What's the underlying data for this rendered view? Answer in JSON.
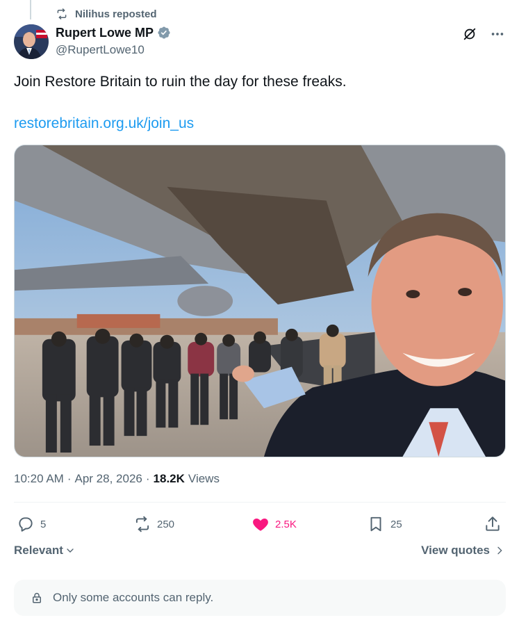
{
  "repost": {
    "label": "Nilihus reposted",
    "icon": "repost-icon"
  },
  "author": {
    "display_name": "Rupert Lowe MP",
    "handle": "@RupertLowe10",
    "verified": true,
    "verified_color": "#829aab"
  },
  "tweet": {
    "text": "Join Restore Britain to ruin the day for these freaks.",
    "link": "restorebritain.org.uk/join_us"
  },
  "meta": {
    "time": "10:20 AM",
    "date": "Apr 28, 2026",
    "views_count": "18.2K",
    "views_label": "Views"
  },
  "actions": {
    "replies": "5",
    "reposts": "250",
    "likes": "2.5K",
    "bookmarks": "25"
  },
  "sort": {
    "label": "Relevant"
  },
  "quotes": {
    "label": "View quotes"
  },
  "reply_restriction": {
    "label": "Only some accounts can reply."
  },
  "colors": {
    "accent": "#1d9bf0",
    "like": "#f91880",
    "muted": "#536471"
  }
}
